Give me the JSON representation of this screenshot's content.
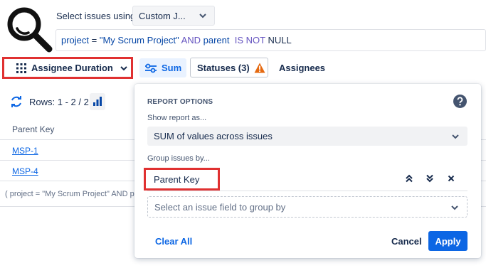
{
  "header": {
    "select_label": "Select issues using",
    "select_value": "Custom J...",
    "jql": {
      "field": "project",
      "op": " = ",
      "value": "\"My Scrum Project\"",
      "and": " AND ",
      "field2": "parent",
      "is": "  IS NOT ",
      "null": "NULL"
    }
  },
  "toolbar": {
    "report_type": "Assignee Duration",
    "sum_label": "Sum",
    "statuses_label": "Statuses (3)",
    "assignees_label": "Assignees"
  },
  "table": {
    "rows_label": "Rows: 1 - 2 / 2",
    "column_header": "Parent Key",
    "rows": [
      "MSP-1",
      "MSP-4"
    ],
    "footer_jql": "( project = \"My Scrum Project\" AND parent IS NOT NULL )"
  },
  "report_options": {
    "title": "REPORT OPTIONS",
    "show_report_label": "Show report as...",
    "show_report_value": "SUM of values across issues",
    "group_label": "Group issues by...",
    "group_item": "Parent Key",
    "field_placeholder": "Select an issue field to group by",
    "clear_all": "Clear All",
    "cancel": "Cancel",
    "apply": "Apply"
  },
  "colors": {
    "accent": "#0c66e4",
    "highlight_border": "#e03131",
    "warning": "#e56910"
  },
  "icons": [
    "magnifier-logo",
    "chevron-down-icon",
    "grid-icon",
    "sliders-icon",
    "warning-icon",
    "refresh-icon",
    "bar-chart-icon",
    "help-icon",
    "move-up-icon",
    "move-down-icon",
    "close-icon"
  ]
}
